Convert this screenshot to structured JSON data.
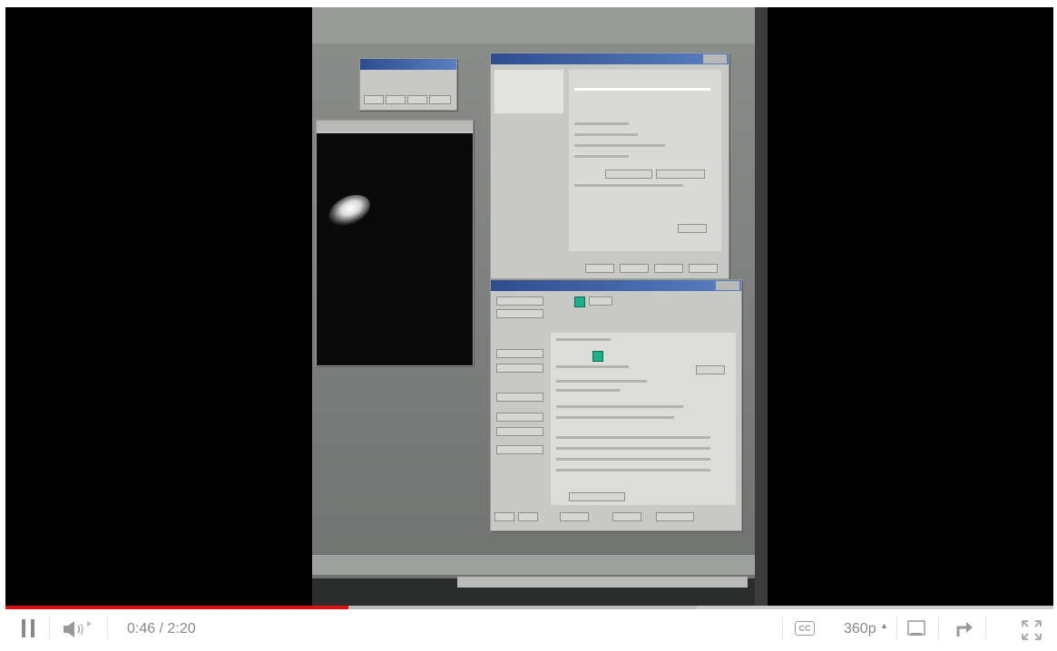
{
  "player": {
    "progress": {
      "played_fraction": 0.327,
      "loaded_fraction": 0.66
    },
    "time": {
      "current": "0:46",
      "separator": " / ",
      "total": "2:20"
    },
    "quality_label": "360p",
    "cc_label": "CC",
    "colors": {
      "played": "#dd1111",
      "loaded": "#bbbbbb",
      "track": "#cccccc"
    },
    "icons": [
      "pause-icon",
      "volume-icon",
      "cc-icon",
      "quality-icon",
      "popout-icon",
      "share-icon",
      "fullscreen-icon"
    ]
  }
}
